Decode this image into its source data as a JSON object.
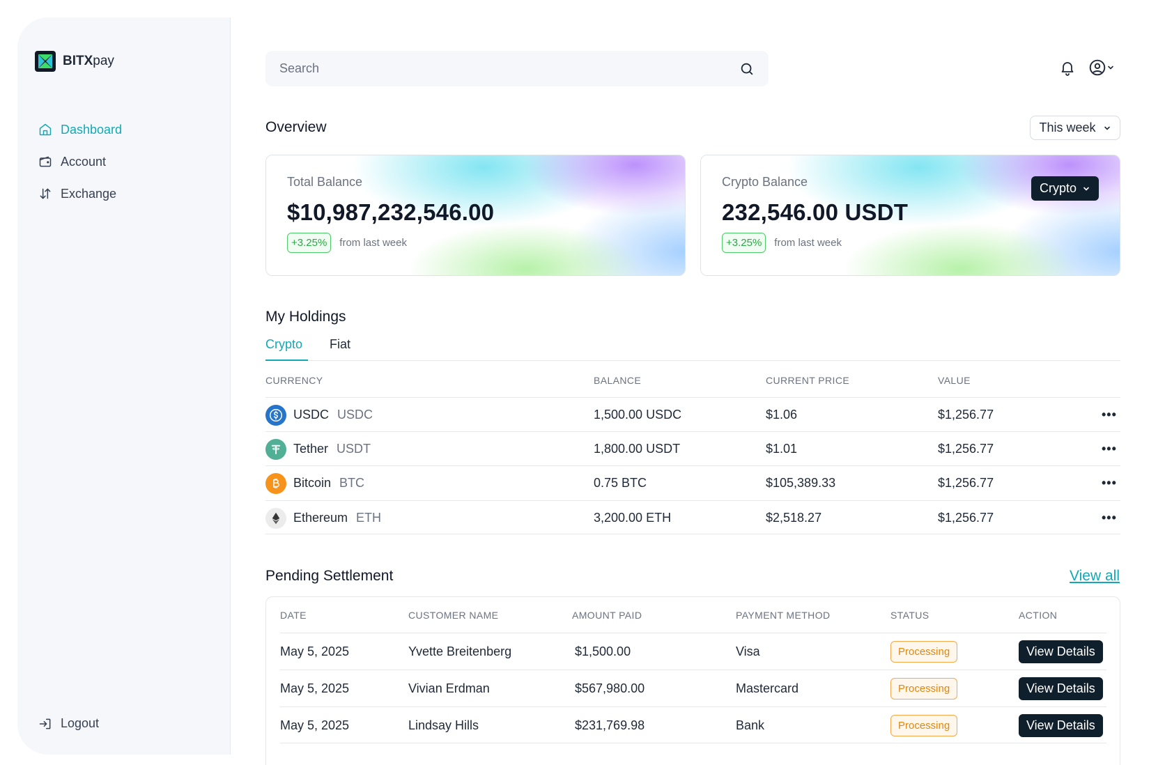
{
  "brand": {
    "name_bold": "BITX",
    "name_rest": "pay",
    "colors": {
      "accent": "#12a9b5",
      "dark": "#0f1f2c"
    }
  },
  "sidebar": {
    "items": [
      {
        "label": "Dashboard",
        "icon": "home-icon",
        "active": true
      },
      {
        "label": "Account",
        "icon": "wallet-icon",
        "active": false
      },
      {
        "label": "Exchange",
        "icon": "exchange-icon",
        "active": false
      }
    ],
    "logout_label": "Logout"
  },
  "search": {
    "placeholder": "Search"
  },
  "overview": {
    "title": "Overview",
    "period": "This week",
    "total": {
      "label": "Total Balance",
      "value": "$10,987,232,546.00",
      "change": "+3.25%",
      "change_note": "from last week"
    },
    "crypto": {
      "label": "Crypto Balance",
      "value": "232,546.00 USDT",
      "change": "+3.25%",
      "change_note": "from last week",
      "selector": "Crypto"
    }
  },
  "holdings": {
    "title": "My Holdings",
    "tabs": [
      {
        "label": "Crypto",
        "active": true
      },
      {
        "label": "Fiat",
        "active": false
      }
    ],
    "columns": [
      "CURRENCY",
      "BALANCE",
      "CURRENT PRICE",
      "VALUE"
    ],
    "rows": [
      {
        "name": "USDC",
        "symbol": "USDC",
        "balance": "1,500.00 USDC",
        "price": "$1.06",
        "value": "$1,256.77",
        "icon": "usdc-icon",
        "color": "#2775ca"
      },
      {
        "name": "Tether",
        "symbol": "USDT",
        "balance": "1,800.00 USDT",
        "price": "$1.01",
        "value": "$1,256.77",
        "icon": "tether-icon",
        "color": "#50af95"
      },
      {
        "name": "Bitcoin",
        "symbol": "BTC",
        "balance": "0.75 BTC",
        "price": "$105,389.33",
        "value": "$1,256.77",
        "icon": "bitcoin-icon",
        "color": "#f7931a"
      },
      {
        "name": "Ethereum",
        "symbol": "ETH",
        "balance": "3,200.00 ETH",
        "price": "$2,518.27",
        "value": "$1,256.77",
        "icon": "ethereum-icon",
        "color": "#ececec"
      }
    ],
    "more_label": "•••"
  },
  "pending": {
    "title": "Pending Settlement",
    "view_all": "View all",
    "columns": [
      "DATE",
      "CUSTOMER NAME",
      "AMOUNT PAID",
      "PAYMENT METHOD",
      "STATUS",
      "ACTION"
    ],
    "rows": [
      {
        "date": "May 5, 2025",
        "customer": "Yvette Breitenberg",
        "amount": "$1,500.00",
        "method": "Visa",
        "status": "Processing",
        "action": "View Details"
      },
      {
        "date": "May 5, 2025",
        "customer": "Vivian Erdman",
        "amount": "$567,980.00",
        "method": "Mastercard",
        "status": "Processing",
        "action": "View Details"
      },
      {
        "date": "May 5, 2025",
        "customer": "Lindsay Hills",
        "amount": "$231,769.98",
        "method": "Bank",
        "status": "Processing",
        "action": "View Details"
      }
    ]
  }
}
